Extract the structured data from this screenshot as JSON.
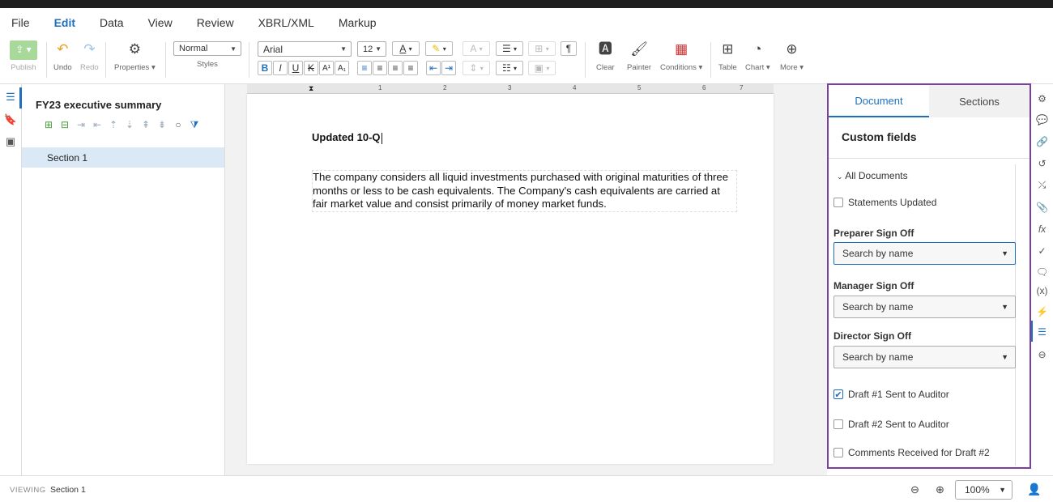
{
  "menu": [
    "File",
    "Edit",
    "Data",
    "View",
    "Review",
    "XBRL/XML",
    "Markup"
  ],
  "toolbar": {
    "publish_label": "Publish",
    "undo_label": "Undo",
    "redo_label": "Redo",
    "properties_label": "Properties",
    "style_value": "Normal",
    "styles_label": "Styles",
    "font_value": "Arial",
    "size_value": "12",
    "clear_label": "Clear",
    "painter_label": "Painter",
    "conditions_label": "Conditions",
    "table_label": "Table",
    "chart_label": "Chart",
    "more_label": "More",
    "superscript": "A¹",
    "subscript": "A₁"
  },
  "outline": {
    "doc_title": "FY23 executive summary",
    "section": "Section 1"
  },
  "ruler": [
    "1",
    "2",
    "3",
    "4",
    "5",
    "6",
    "7"
  ],
  "page": {
    "heading": "Updated 10-Q",
    "paragraph": "The company considers all liquid investments purchased with original maturities of three months or less to be cash equivalents. The Company's cash equivalents are carried at fair market value and consist primarily of money market funds."
  },
  "panel": {
    "tab_document": "Document",
    "tab_sections": "Sections",
    "title": "Custom fields",
    "group": "All Documents",
    "statements_updated": "Statements Updated",
    "preparer_label": "Preparer Sign Off",
    "manager_label": "Manager Sign Off",
    "director_label": "Director Sign Off",
    "search_placeholder": "Search by name",
    "draft1": "Draft #1 Sent to Auditor",
    "draft2": "Draft #2 Sent to Auditor",
    "comments": "Comments Received for Draft #2",
    "draft1_checked": true
  },
  "status": {
    "mode": "VIEWING",
    "section": "Section 1",
    "zoom": "100%"
  },
  "colors": {
    "accent": "#1f6fbf",
    "panel_border": "#7b3fa0",
    "section_highlight": "#dbe9f6"
  }
}
